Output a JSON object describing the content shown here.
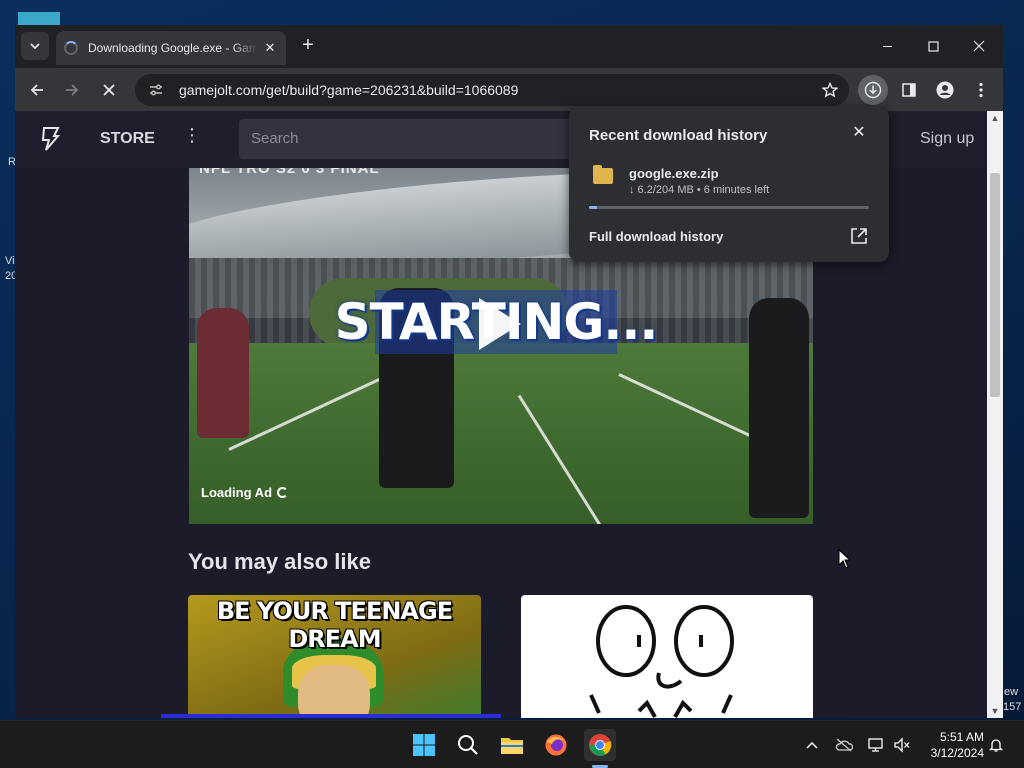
{
  "browser": {
    "tab_title": "Downloading Google.exe - Game Jolt",
    "url": "gamejolt.com/get/build?game=206231&build=1066089"
  },
  "site": {
    "store_label": "STORE",
    "search_placeholder": "Search",
    "signup_label": "Sign up"
  },
  "video": {
    "overlay_top_text": "NFL TRO S2 0 3 FINAL",
    "starting_text": "STARTING...",
    "loading_ad": "Loading Ad"
  },
  "section": {
    "also_like": "You may also like"
  },
  "cards": [
    {
      "caption": "BE YOUR TEENAGE DREAM"
    },
    {
      "caption": ""
    }
  ],
  "download_popup": {
    "title": "Recent download history",
    "file_name": "google.exe.zip",
    "file_meta": "↓ 6.2/204 MB • 6 minutes left",
    "progress": 0.03,
    "full_history": "Full download history"
  },
  "desktop_labels": {
    "left_r": "R",
    "left_vi": "Vi",
    "left_20": "20",
    "right_ew": "ew",
    "right_157": "157"
  },
  "taskbar": {
    "time": "5:51 AM",
    "date": "3/12/2024"
  },
  "colors": {
    "accent_blue": "#8ab4f8",
    "page_bg": "#1c1b29"
  }
}
